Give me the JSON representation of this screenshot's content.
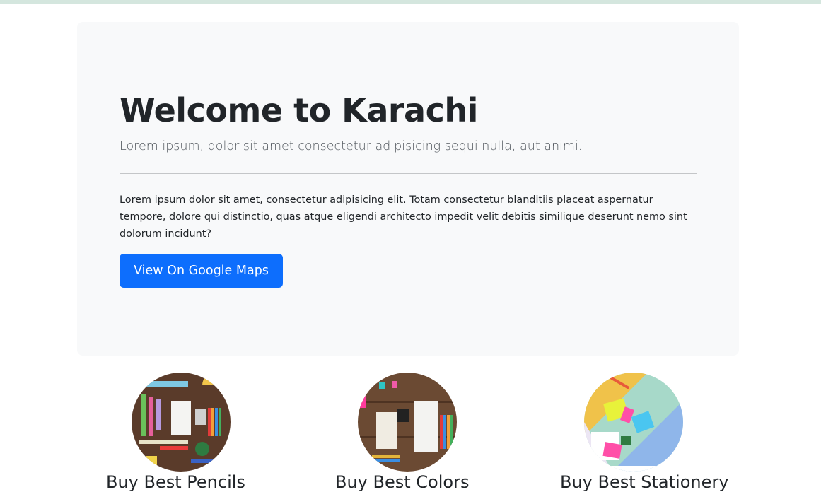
{
  "hero": {
    "title": "Welcome to Karachi",
    "lead": "Lorem ipsum, dolor sit amet consectetur adipisicing sequi nulla, aut animi.",
    "body": "Lorem ipsum dolor sit amet, consectetur adipisicing elit. Totam consectetur blanditiis placeat aspernatur tempore, dolore qui distinctio, quas atque eligendi architecto impedit velit debitis similique deserunt nemo sint dolorum incidunt?",
    "button_label": "View On Google Maps"
  },
  "cards": [
    {
      "image": "stationery-flatlay-image",
      "caption": "Buy Best Pencils"
    },
    {
      "image": "notebook-colors-image",
      "caption": "Buy Best Colors"
    },
    {
      "image": "pastel-supplies-image",
      "caption": "Buy Best Stationery"
    }
  ],
  "colors": {
    "primary": "#0d6efd",
    "jumbotron": "#f8f9fa",
    "top_bar": "#d4e6de"
  }
}
